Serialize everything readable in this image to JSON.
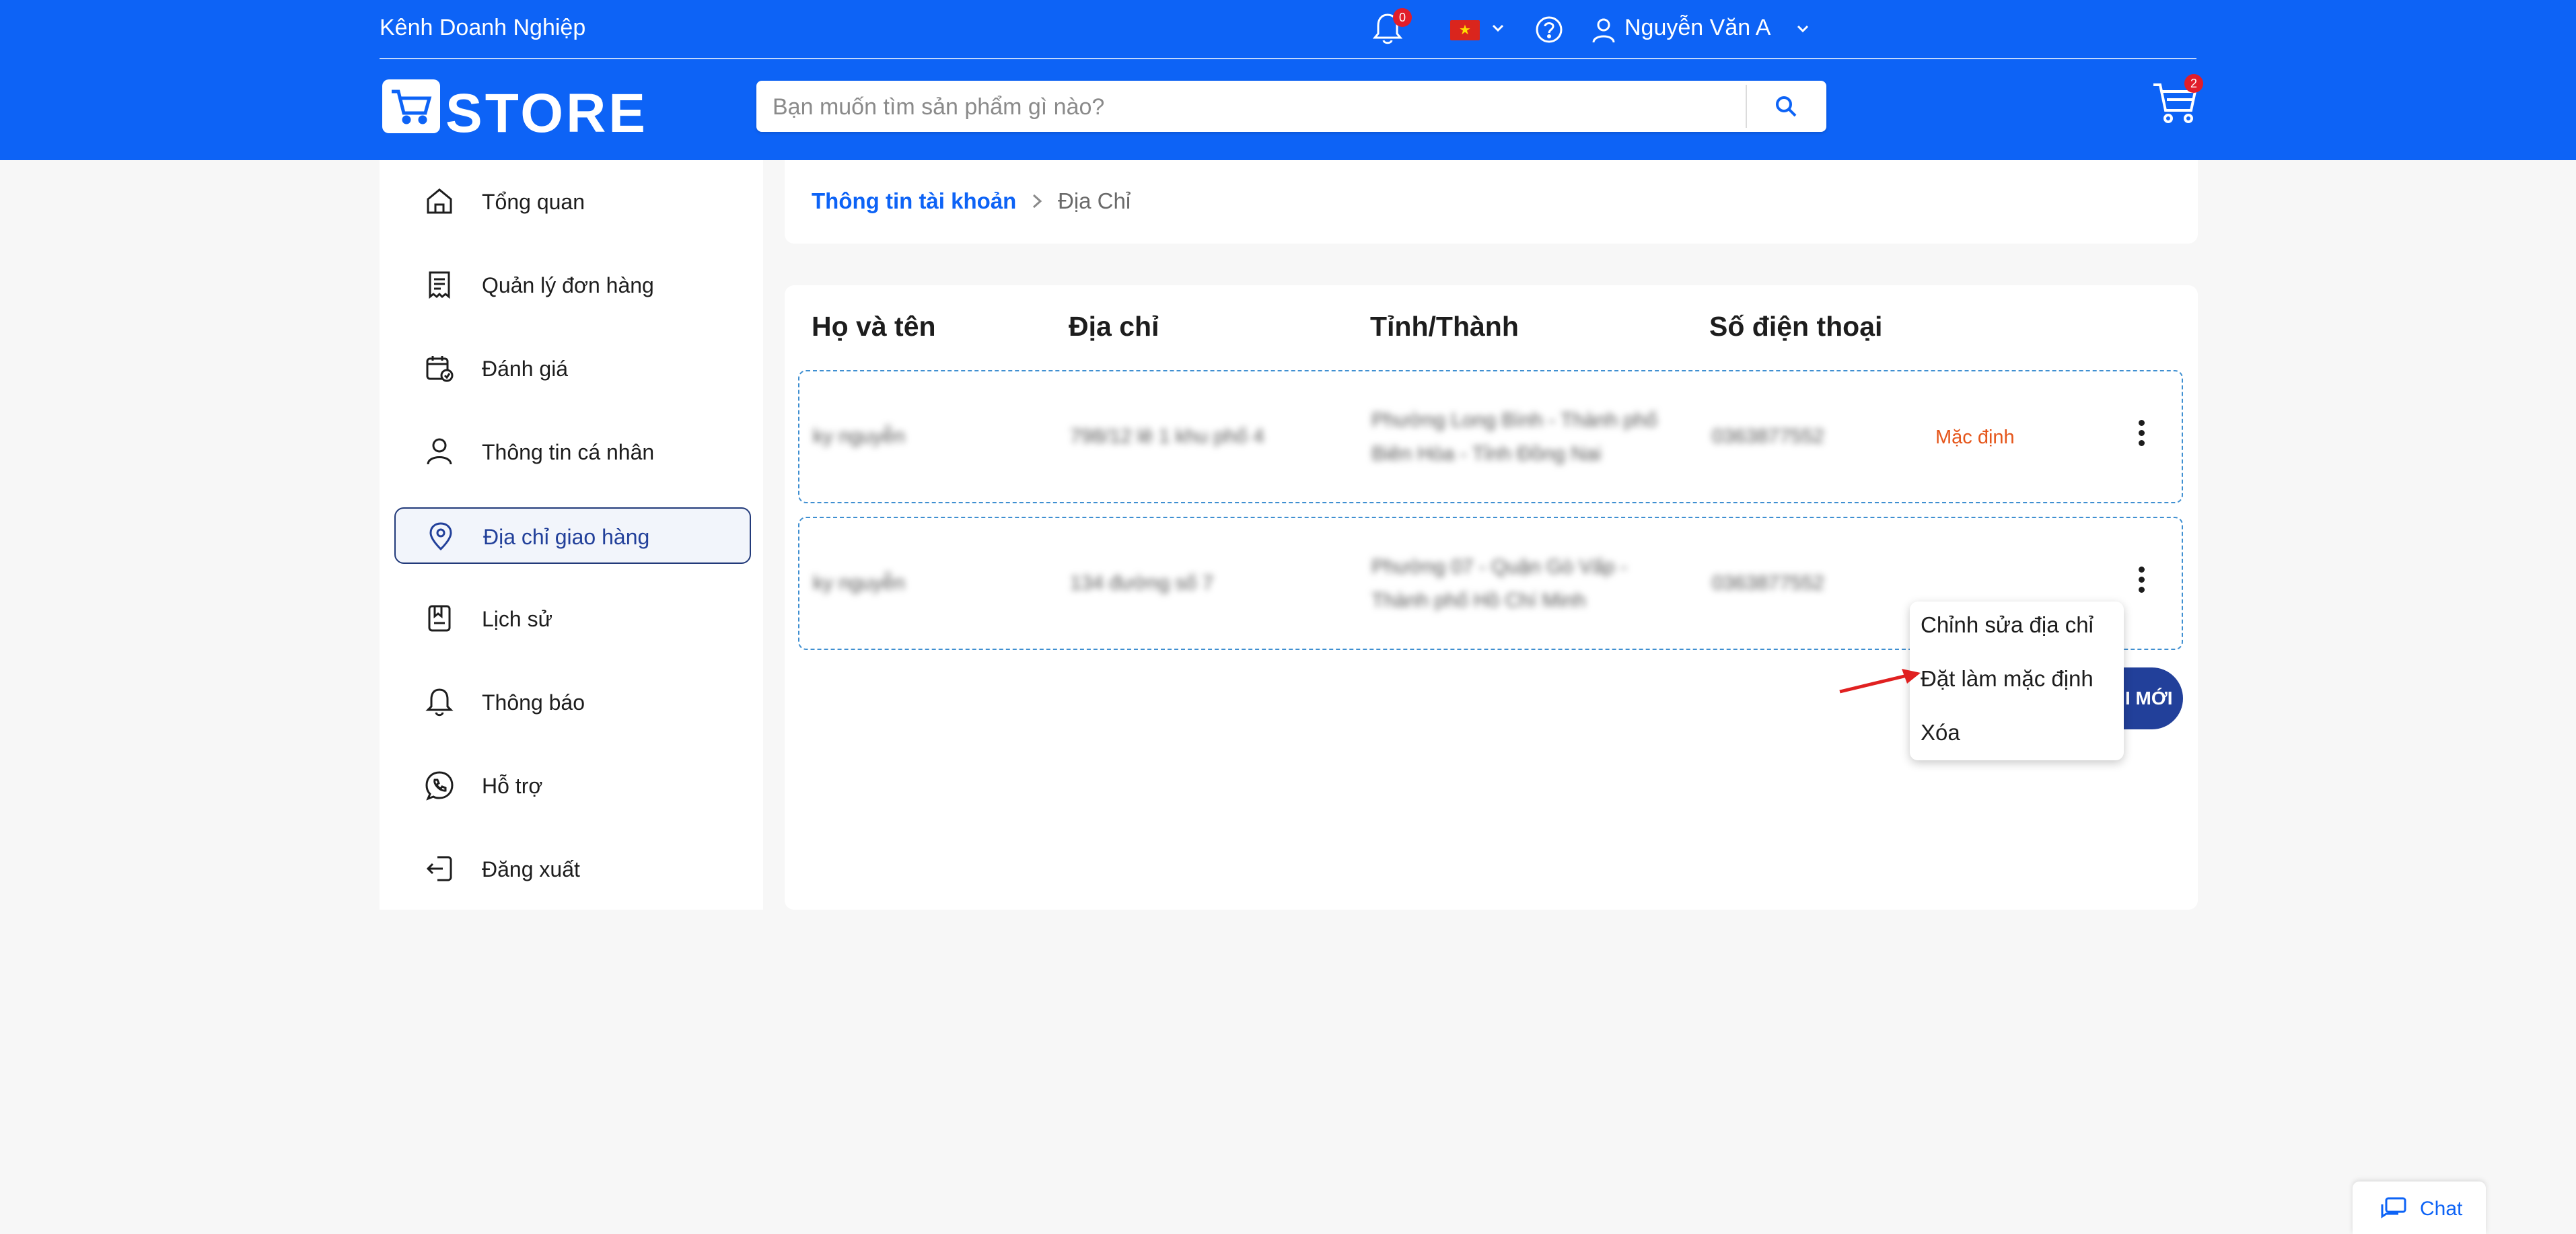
{
  "header": {
    "channel_label": "Kênh Doanh Nghiệp",
    "notification_count": "0",
    "language_flag_glyph": "★",
    "user_name": "Nguyễn Văn A",
    "logo_text": "STORE",
    "search_placeholder": "Bạn muốn tìm sản phẩm gì nào?",
    "cart_count": "2",
    "colors": {
      "primary": "#0d63f6",
      "badge": "#e11d2a"
    }
  },
  "sidebar": {
    "items": [
      {
        "label": "Tổng quan",
        "icon": "home-icon"
      },
      {
        "label": "Quản lý đơn hàng",
        "icon": "receipt-icon"
      },
      {
        "label": "Đánh giá",
        "icon": "calendar-review-icon"
      },
      {
        "label": "Thông tin cá nhân",
        "icon": "user-icon"
      },
      {
        "label": "Địa chỉ giao hàng",
        "icon": "location-pin-icon",
        "active": true
      },
      {
        "label": "Lịch sử",
        "icon": "history-icon"
      },
      {
        "label": "Thông báo",
        "icon": "bell-icon"
      },
      {
        "label": "Hỗ trợ",
        "icon": "phone-support-icon"
      },
      {
        "label": "Đăng xuất",
        "icon": "logout-icon"
      }
    ]
  },
  "breadcrumb": {
    "parent": "Thông tin tài khoản",
    "current": "Địa Chỉ"
  },
  "address_table": {
    "columns": [
      "Họ và tên",
      "Địa chỉ",
      "Tỉnh/Thành",
      "Số điện thoại"
    ],
    "rows": [
      {
        "name": "ky nguyễn",
        "address": "798/12 lê 1 khu phố 4",
        "city_line1": "Phường Long Bình - Thành phố",
        "city_line2": "Biên Hòa - Tỉnh Đồng Nai",
        "phone": "0363877552",
        "default_label": "Mặc định"
      },
      {
        "name": "ky nguyễn",
        "address": "134 đường số 7",
        "city_line1": "Phường 07 - Quận Gò Vấp -",
        "city_line2": "Thành phố Hồ Chí Minh",
        "phone": "0363877552",
        "default_label": ""
      }
    ],
    "add_button_label": "I MỚI"
  },
  "row_menu": {
    "items": [
      "Chỉnh sửa địa chỉ",
      "Đặt làm mặc định",
      "Xóa"
    ]
  },
  "chat": {
    "label": "Chat"
  }
}
